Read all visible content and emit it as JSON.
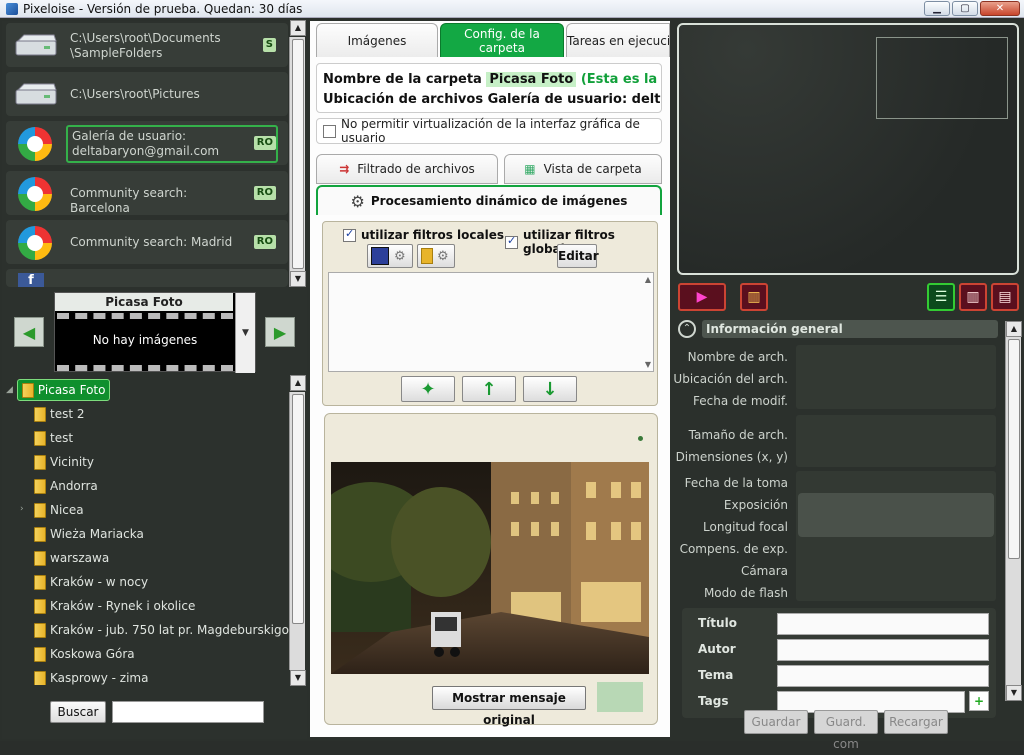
{
  "window": {
    "title": "Pixeloise - Versión de prueba. Quedan: 30 días",
    "controls": [
      "minimize",
      "maximize",
      "close"
    ]
  },
  "drives": [
    {
      "label": "C:\\Users\\root\\Documents\n\\SampleFolders",
      "badge": "S",
      "icon": "drive-icon"
    },
    {
      "label": "C:\\Users\\root\\Pictures",
      "badge": "",
      "icon": "drive-icon"
    },
    {
      "label": "Galería de usuario:\ndeltabaryon@gmail.com",
      "badge": "RO",
      "icon": "picasa-icon"
    },
    {
      "label": "Community search: Barcelona",
      "badge": "RO",
      "icon": "picasa-icon"
    },
    {
      "label": "Community search: Madrid",
      "badge": "RO",
      "icon": "picasa-icon"
    }
  ],
  "filmstrip": {
    "title": "Picasa Foto",
    "empty_message": "No hay imágenes"
  },
  "tree": {
    "root": "Picasa Foto",
    "items": [
      "test 2",
      "test",
      "Vicinity",
      "Andorra",
      "Nicea",
      "Wieża Mariacka",
      "warszawa",
      "Kraków - w nocy",
      "Kraków - Rynek i okolice",
      "Kraków - jub. 750 lat pr. Magdeburskigo",
      "Koskowa Góra",
      "Kasprowy - zima"
    ]
  },
  "search": {
    "button": "Buscar",
    "value": ""
  },
  "center": {
    "tabs": [
      "Imágenes",
      "Config. de la carpeta",
      "Tareas en ejecució"
    ],
    "folder_name_label": "Nombre de la carpeta",
    "folder_name_value": "Picasa Foto",
    "folder_name_note": "(Esta es la carpe",
    "location_label": "Ubicación de archivos",
    "location_value": "Galería de usuario: deltabary",
    "no_virtualize": "No permitir virtualización de la interfaz gráfica de usuario",
    "subtabs": [
      "Filtrado de archivos",
      "Vista de carpeta"
    ],
    "dynamic_tab": "Procesamiento dinámico de imágenes",
    "local_filters": "utilizar filtros locales",
    "global_filters": "utilizar filtros globales",
    "edit": "Editar",
    "show_original": "Mostrar mensaje original"
  },
  "info": {
    "header": "Información general",
    "labels": [
      "Nombre de arch.",
      "Ubicación del arch.",
      "Fecha de modif.",
      "Tamaño de arch.",
      "Dimensiones (x, y)",
      "Fecha de la toma",
      "Exposición",
      "Longitud focal",
      "Compens. de exp.",
      "Cámara",
      "Modo de flash"
    ],
    "meta_labels": [
      "Título",
      "Autor",
      "Tema",
      "Tags"
    ]
  },
  "bottom_buttons": [
    "Guardar",
    "Guard. com",
    "Recargar"
  ]
}
